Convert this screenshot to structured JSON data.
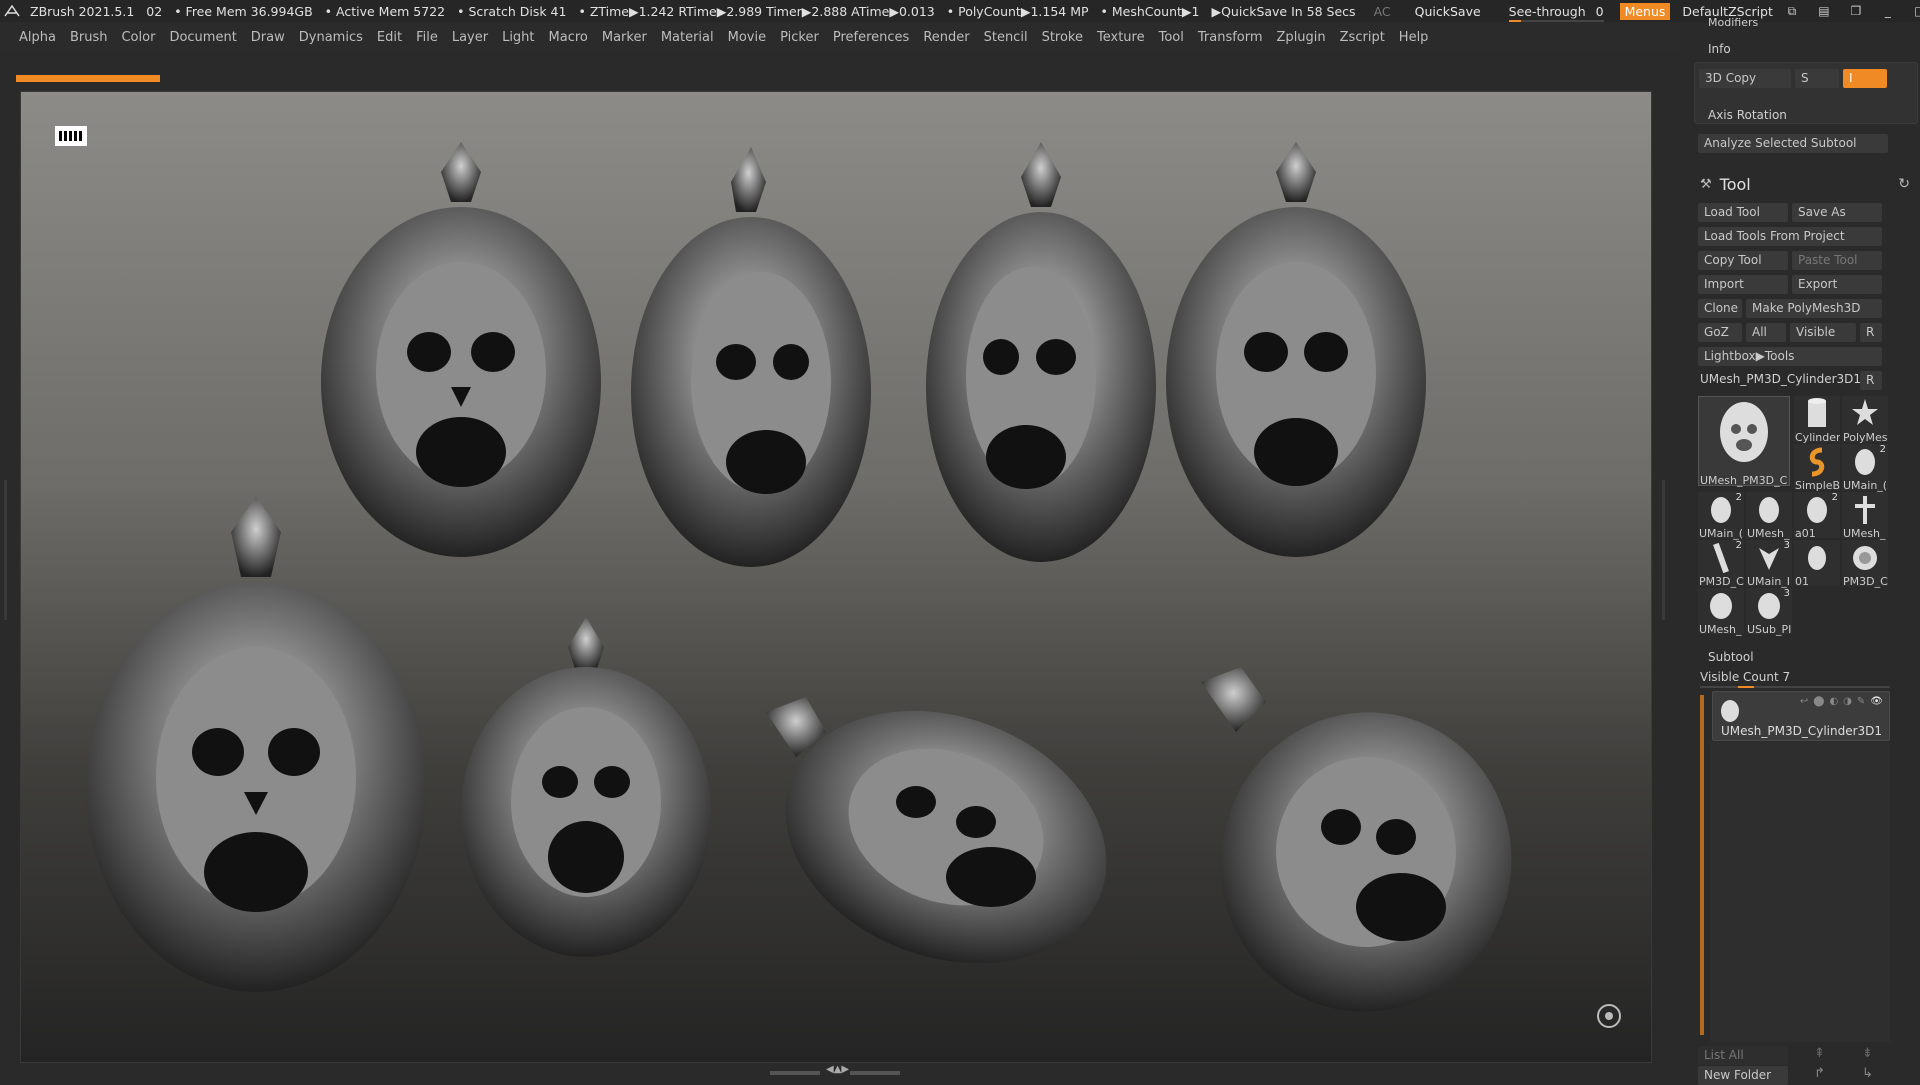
{
  "titlebar": {
    "app": "ZBrush 2021.5.1",
    "doc": "02",
    "free_mem": "• Free Mem 36.994GB",
    "active_mem": "• Active Mem 5722",
    "scratch": "• Scratch Disk 41",
    "ztime": "• ZTime▶1.242 RTime▶2.989 Timer▶2.888 ATime▶0.013",
    "polycount": "• PolyCount▶1.154 MP",
    "meshcount": "• MeshCount▶1",
    "quicksave_in": "▶QuickSave In 58 Secs",
    "ac": "AC",
    "quicksave": "QuickSave",
    "see_through_label": "See-through",
    "see_through_value": "0",
    "menus": "Menus",
    "script": "DefaultZScript",
    "win_icons": [
      "restore-icon",
      "layout-icon",
      "window-icon",
      "minimize-icon",
      "maximize-icon",
      "close-icon"
    ]
  },
  "menubar": [
    "Alpha",
    "Brush",
    "Color",
    "Document",
    "Draw",
    "Dynamics",
    "Edit",
    "File",
    "Layer",
    "Light",
    "Macro",
    "Marker",
    "Material",
    "Movie",
    "Picker",
    "Preferences",
    "Render",
    "Stencil",
    "Stroke",
    "Texture",
    "Tool",
    "Transform",
    "Zplugin",
    "Zscript",
    "Help"
  ],
  "side": {
    "modifiers": "Modifiers",
    "info": "Info",
    "copy3d": "3D Copy",
    "s_label": "S",
    "i_label": "I",
    "axis_rotation": "Axis Rotation",
    "analyze": "Analyze Selected Subtool",
    "tool_title": "Tool",
    "load_tool": "Load Tool",
    "save_as": "Save As",
    "load_from_project": "Load Tools From Project",
    "copy_tool": "Copy Tool",
    "paste_tool": "Paste Tool",
    "import": "Import",
    "export": "Export",
    "clone": "Clone",
    "make_polymesh": "Make PolyMesh3D",
    "goz": "GoZ",
    "all": "All",
    "visible": "Visible",
    "r": "R",
    "lightbox_tools": "Lightbox▶Tools",
    "current_tool": "UMesh_PM3D_Cylinder3D1",
    "r2": "R",
    "thumbs": [
      {
        "label": "UMesh_PM3D_C",
        "count": ""
      },
      {
        "label": "Cylinder",
        "count": ""
      },
      {
        "label": "PolyMes",
        "count": ""
      },
      {
        "label": "SimpleB",
        "count": ""
      },
      {
        "label": "UMain_(",
        "count": "2"
      },
      {
        "label": "UMain_(",
        "count": "2"
      },
      {
        "label": "UMesh_",
        "count": ""
      },
      {
        "label": "a01",
        "count": "2"
      },
      {
        "label": "UMesh_",
        "count": ""
      },
      {
        "label": "PM3D_C",
        "count": "2"
      },
      {
        "label": "UMain_I",
        "count": "3"
      },
      {
        "label": "01",
        "count": ""
      },
      {
        "label": "PM3D_C",
        "count": ""
      },
      {
        "label": "UMesh_",
        "count": ""
      },
      {
        "label": "USub_PI",
        "count": "3"
      }
    ],
    "subtool": "Subtool",
    "visible_count": "Visible Count 7",
    "subtool_name": "UMesh_PM3D_Cylinder3D1",
    "list_all": "List All",
    "new_folder": "New Folder"
  }
}
